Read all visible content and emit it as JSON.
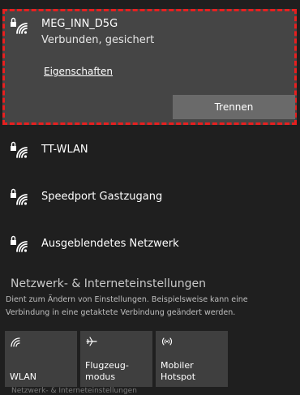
{
  "connected": {
    "name": "MEG_INN_D5G",
    "status": "Verbunden, gesichert",
    "properties_link": "Eigenschaften",
    "disconnect_button": "Trennen"
  },
  "networks": [
    {
      "name": "TT-WLAN"
    },
    {
      "name": "Speedport Gastzugang"
    },
    {
      "name": "Ausgeblendetes Netzwerk"
    }
  ],
  "settings": {
    "title": "Netzwerk- & Interneteinstellungen",
    "description": "Dient zum Ändern von Einstellungen. Beispielsweise kann eine Verbindung in eine getaktete Verbindung geändert werden."
  },
  "quick_actions": [
    {
      "label": "WLAN",
      "icon": "wifi-icon"
    },
    {
      "label": "Flugzeug-\nmodus",
      "icon": "airplane-icon"
    },
    {
      "label": "Mobiler\nHotspot",
      "icon": "hotspot-icon"
    }
  ],
  "bottom_fade_text": "Netzwerk- & Interneteinstellungen",
  "colors": {
    "background": "#1f1f1f",
    "connected_card": "#454545",
    "highlight_border": "#e81f1f",
    "button": "#6a6a6a",
    "tile": "#3f3f3f"
  }
}
